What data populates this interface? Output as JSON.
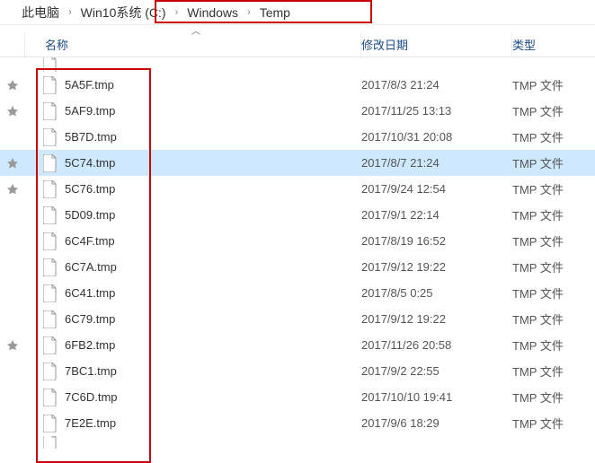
{
  "breadcrumb": {
    "items": [
      "此电脑",
      "Win10系统 (C:)",
      "Windows",
      "Temp"
    ]
  },
  "columns": {
    "name": "名称",
    "date": "修改日期",
    "type": "类型"
  },
  "partial_top": {
    "date": "",
    "type": ""
  },
  "files": [
    {
      "name": "5A5F.tmp",
      "date": "2017/8/3 21:24",
      "type": "TMP 文件",
      "pinned": true,
      "selected": false
    },
    {
      "name": "5AF9.tmp",
      "date": "2017/11/25 13:13",
      "type": "TMP 文件",
      "pinned": true,
      "selected": false
    },
    {
      "name": "5B7D.tmp",
      "date": "2017/10/31 20:08",
      "type": "TMP 文件",
      "pinned": false,
      "selected": false
    },
    {
      "name": "5C74.tmp",
      "date": "2017/8/7 21:24",
      "type": "TMP 文件",
      "pinned": true,
      "selected": true
    },
    {
      "name": "5C76.tmp",
      "date": "2017/9/24 12:54",
      "type": "TMP 文件",
      "pinned": true,
      "selected": false
    },
    {
      "name": "5D09.tmp",
      "date": "2017/9/1 22:14",
      "type": "TMP 文件",
      "pinned": false,
      "selected": false
    },
    {
      "name": "6C4F.tmp",
      "date": "2017/8/19 16:52",
      "type": "TMP 文件",
      "pinned": false,
      "selected": false
    },
    {
      "name": "6C7A.tmp",
      "date": "2017/9/12 19:22",
      "type": "TMP 文件",
      "pinned": false,
      "selected": false
    },
    {
      "name": "6C41.tmp",
      "date": "2017/8/5 0:25",
      "type": "TMP 文件",
      "pinned": false,
      "selected": false
    },
    {
      "name": "6C79.tmp",
      "date": "2017/9/12 19:22",
      "type": "TMP 文件",
      "pinned": false,
      "selected": false
    },
    {
      "name": "6FB2.tmp",
      "date": "2017/11/26 20:58",
      "type": "TMP 文件",
      "pinned": true,
      "selected": false
    },
    {
      "name": "7BC1.tmp",
      "date": "2017/9/2 22:55",
      "type": "TMP 文件",
      "pinned": false,
      "selected": false
    },
    {
      "name": "7C6D.tmp",
      "date": "2017/10/10 19:41",
      "type": "TMP 文件",
      "pinned": false,
      "selected": false
    },
    {
      "name": "7E2E.tmp",
      "date": "2017/9/6 18:29",
      "type": "TMP 文件",
      "pinned": false,
      "selected": false
    }
  ]
}
